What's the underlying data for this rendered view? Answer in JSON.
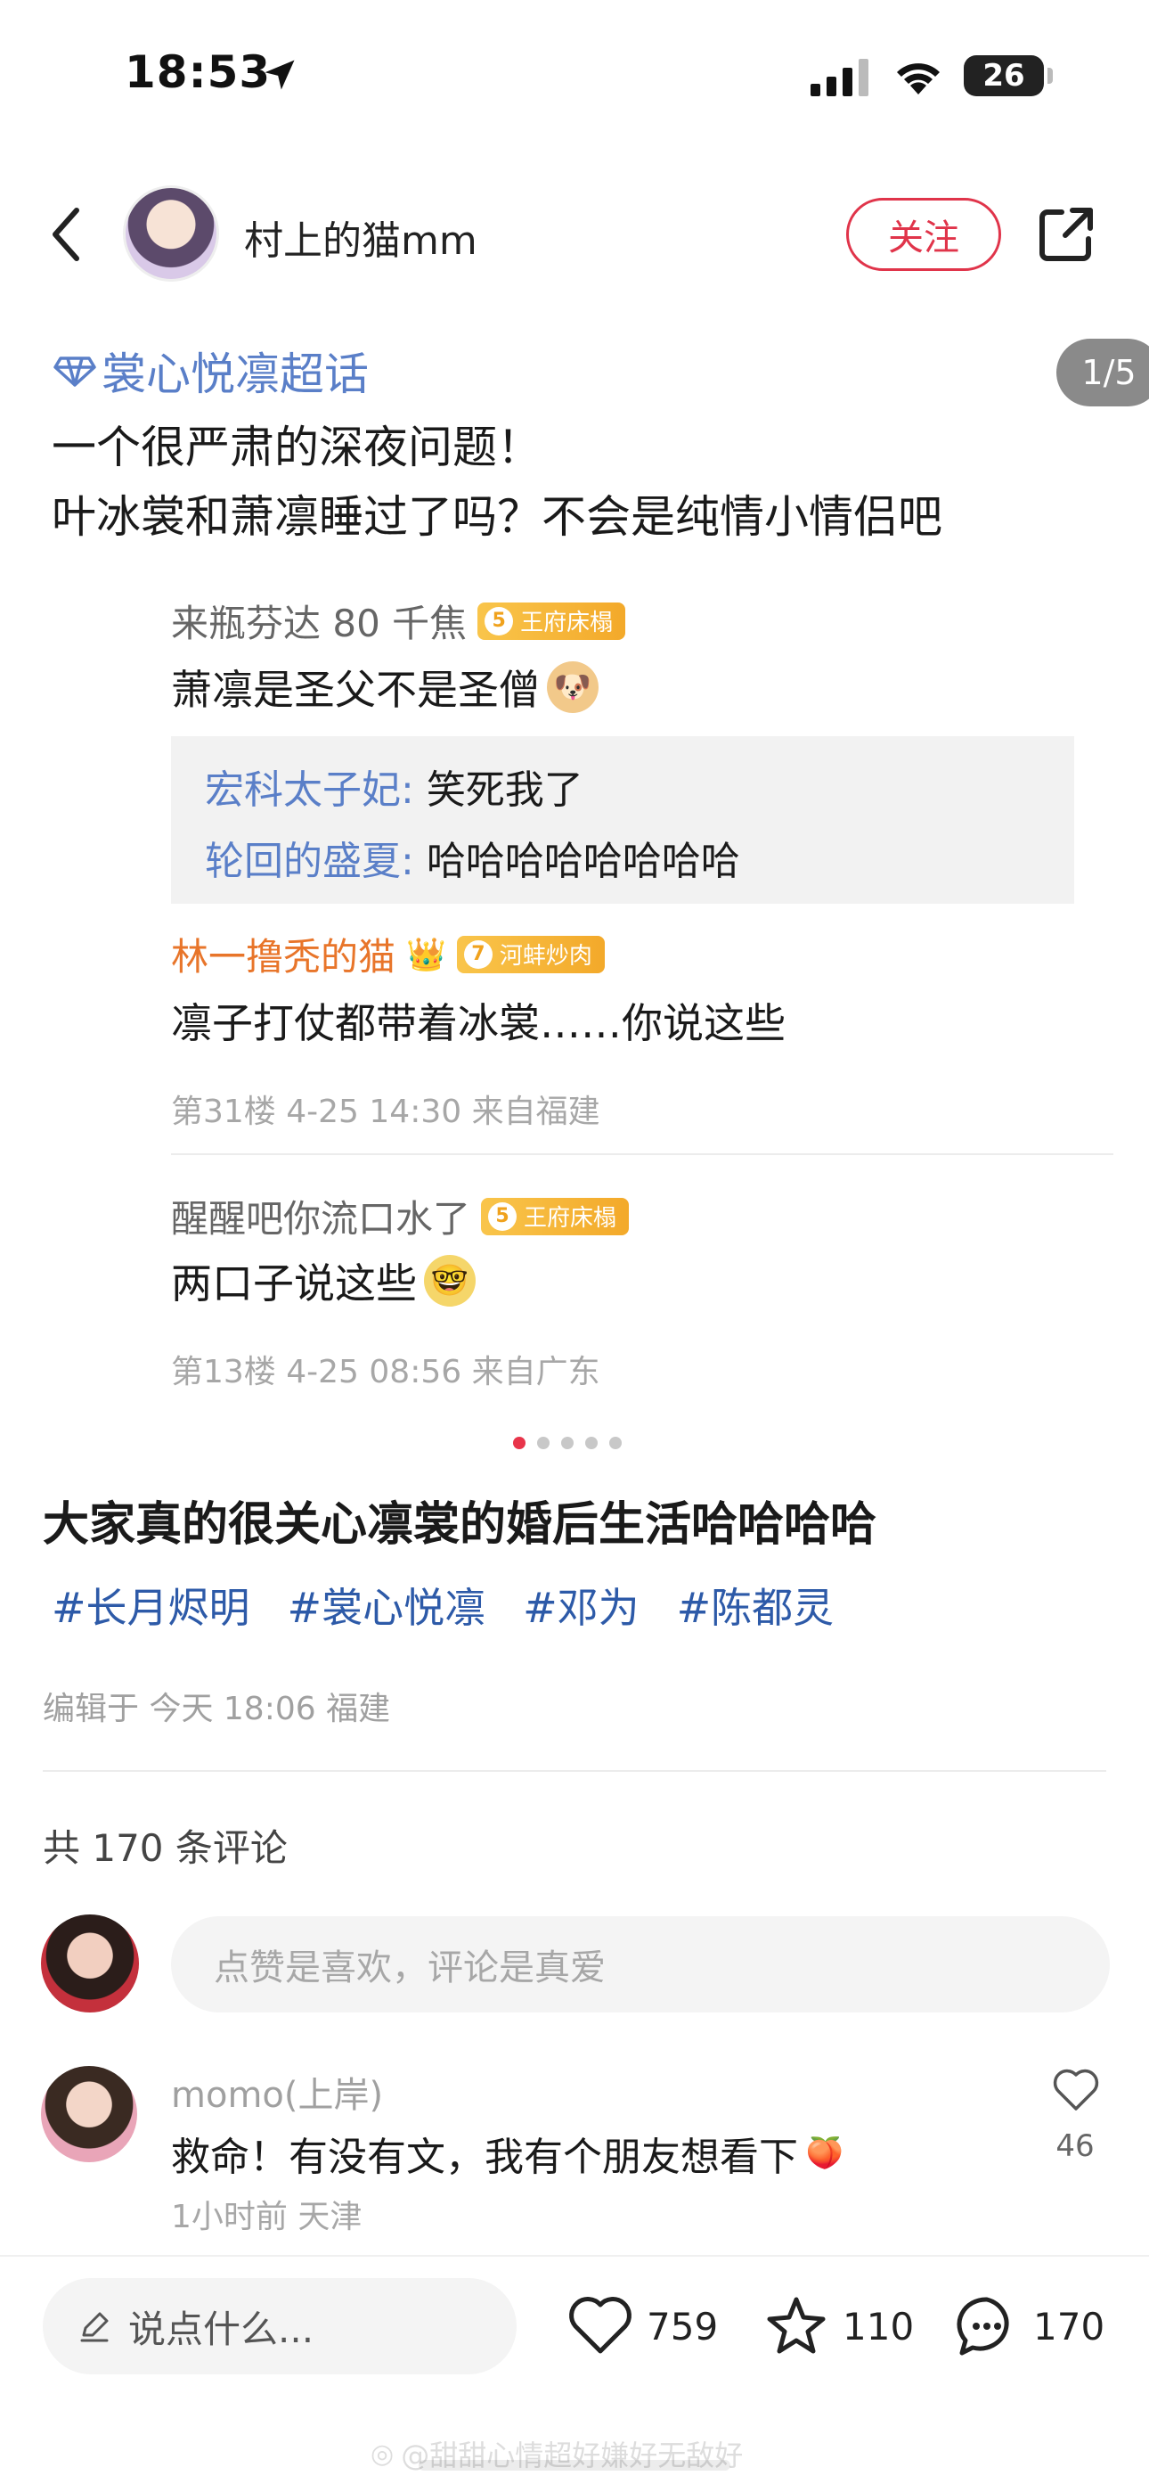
{
  "status_bar": {
    "time": "18:53",
    "battery": "26"
  },
  "header": {
    "author_name": "村上的猫mm",
    "follow_label": "关注"
  },
  "post": {
    "topic_tag": "裳心悦凛超话",
    "page_indicator": "1/5",
    "text_line_1": "一个很严肃的深夜问题！",
    "text_line_2": "叶冰裳和萧凛睡过了吗？不会是纯情小情侣吧",
    "carousel": {
      "count": 5,
      "active_index": 0
    },
    "title": "大家真的很关心凛裳的婚后生活哈哈哈哈",
    "hashtags": [
      "#长月烬明",
      "#裳心悦凛",
      "#邓为",
      "#陈都灵"
    ],
    "edit_info": "编辑于 今天 18:06 福建"
  },
  "screenshot_comments": {
    "c1": {
      "user": "来瓶芬达 80 千焦",
      "badge_level": "5",
      "badge_label": "王府床榻",
      "text": "萧凛是圣父不是圣僧",
      "replies": [
        {
          "name": "宏科太子妃",
          "sep": ": ",
          "text": "笑死我了"
        },
        {
          "name": "轮回的盛夏",
          "sep": ": ",
          "text": "哈哈哈哈哈哈哈哈"
        }
      ]
    },
    "c2": {
      "user": "林一撸秃的猫",
      "badge_level": "7",
      "badge_label": "河蚌炒肉",
      "text": "凛子打仗都带着冰裳……你说这些",
      "meta": "第31楼 4-25 14:30 来自福建"
    },
    "c3": {
      "user": "醒醒吧你流口水了",
      "badge_level": "5",
      "badge_label": "王府床榻",
      "text": "两口子说这些",
      "meta": "第13楼 4-25 08:56 来自广东"
    }
  },
  "comments": {
    "count_label": "共 170 条评论",
    "input_placeholder": "点赞是喜欢，评论是真爱",
    "items": [
      {
        "user": "momo(上岸)",
        "text": "救命！有没有文，我有个朋友想看下",
        "meta": "1小时前 天津",
        "likes": "46"
      }
    ]
  },
  "bottom_bar": {
    "say_placeholder": "说点什么...",
    "likes": "759",
    "favorites": "110",
    "comments": "170"
  },
  "watermark": "@甜甜心情超好嫌好无敌好",
  "colors": {
    "accent_red": "#e0344a",
    "link_blue": "#2d5aa8",
    "topic_blue": "#5a7fc8",
    "badge_gold": "#f3a92a"
  }
}
